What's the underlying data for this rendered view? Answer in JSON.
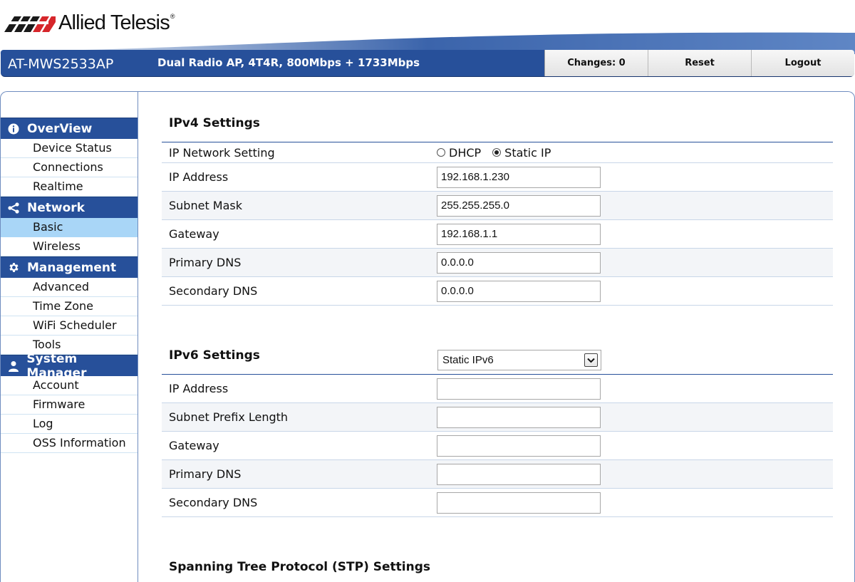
{
  "brand": {
    "name": "Allied Telesis",
    "reg_mark": "®"
  },
  "header": {
    "model": "AT-MWS2533AP",
    "description": "Dual Radio AP, 4T4R, 800Mbps + 1733Mbps",
    "buttons": {
      "changes": "Changes: 0",
      "reset": "Reset",
      "logout": "Logout"
    }
  },
  "sidebar": {
    "overview": {
      "label": "OverView",
      "icon": "info-icon",
      "items": [
        "Device Status",
        "Connections",
        "Realtime"
      ]
    },
    "network": {
      "label": "Network",
      "icon": "share-icon",
      "items": [
        "Basic",
        "Wireless"
      ],
      "active": "Basic"
    },
    "management": {
      "label": "Management",
      "icon": "gear-icon",
      "items": [
        "Advanced",
        "Time Zone",
        "WiFi Scheduler",
        "Tools"
      ]
    },
    "system_manager": {
      "label": "System Manager",
      "icon": "user-icon",
      "items": [
        "Account",
        "Firmware",
        "Log",
        "OSS Information"
      ]
    }
  },
  "ipv4": {
    "title": "IPv4 Settings",
    "network_setting": {
      "label": "IP Network Setting",
      "options": [
        "DHCP",
        "Static IP"
      ],
      "selected": "Static IP"
    },
    "fields": [
      {
        "label": "IP Address",
        "value": "192.168.1.230"
      },
      {
        "label": "Subnet Mask",
        "value": "255.255.255.0"
      },
      {
        "label": "Gateway",
        "value": "192.168.1.1"
      },
      {
        "label": "Primary DNS",
        "value": "0.0.0.0"
      },
      {
        "label": "Secondary DNS",
        "value": "0.0.0.0"
      }
    ]
  },
  "ipv6": {
    "title": "IPv6 Settings",
    "mode": "Static IPv6",
    "fields": [
      {
        "label": "IP Address",
        "value": ""
      },
      {
        "label": "Subnet Prefix Length",
        "value": ""
      },
      {
        "label": "Gateway",
        "value": ""
      },
      {
        "label": "Primary DNS",
        "value": ""
      },
      {
        "label": "Secondary DNS",
        "value": ""
      }
    ]
  },
  "stp": {
    "title": "Spanning Tree Protocol (STP) Settings"
  },
  "colors": {
    "accent": "#27509a",
    "active_nav": "#a9d6f7",
    "logo_red": "#d6262b"
  }
}
